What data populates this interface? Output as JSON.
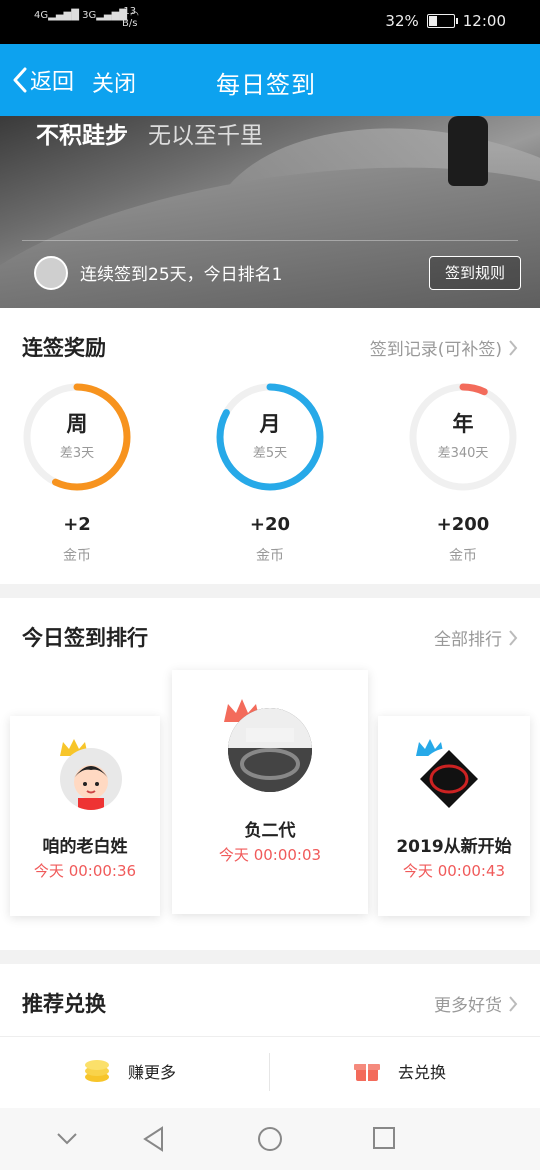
{
  "status_bar": {
    "signal_left": "4G",
    "signal_right": "3G",
    "net_speed_value": "13",
    "net_speed_unit": "B/s",
    "battery": "32%",
    "time": "12:00"
  },
  "nav": {
    "back_label": "返回",
    "close_label": "关闭",
    "title": "每日签到"
  },
  "banner": {
    "quote_bold": "不积跬步",
    "quote_rest": "无以至千里",
    "streak_info": "连续签到25天，今日排名1",
    "rules_button": "签到规则"
  },
  "rewards": {
    "title": "连签奖励",
    "record_link": "签到记录(可补签)",
    "items": [
      {
        "label": "周",
        "remaining": "差3天",
        "amount": "+2",
        "unit": "金币",
        "color": "#f7931e",
        "progress": 0.57
      },
      {
        "label": "月",
        "remaining": "差5天",
        "amount": "+20",
        "unit": "金币",
        "color": "#27a9e8",
        "progress": 0.83
      },
      {
        "label": "年",
        "remaining": "差340天",
        "amount": "+200",
        "unit": "金币",
        "color": "#f36b5b",
        "progress": 0.07
      }
    ]
  },
  "ranking": {
    "title": "今日签到排行",
    "all_link": "全部排行",
    "entries": [
      {
        "name": "咱的老白姓",
        "time": "今天 00:00:36",
        "crown_color": "#f7c52a"
      },
      {
        "name": "负二代",
        "time": "今天 00:00:03",
        "crown_color": "#f36b5b"
      },
      {
        "name": "2019从新开始",
        "time": "今天 00:00:43",
        "crown_color": "#27a9e8"
      }
    ]
  },
  "exchange": {
    "title": "推荐兑换",
    "more_link": "更多好货",
    "earn_more": "赚更多",
    "go_exchange": "去兑换"
  },
  "colors": {
    "brand": "#0da2ef",
    "accent_red": "#f05a5a"
  }
}
